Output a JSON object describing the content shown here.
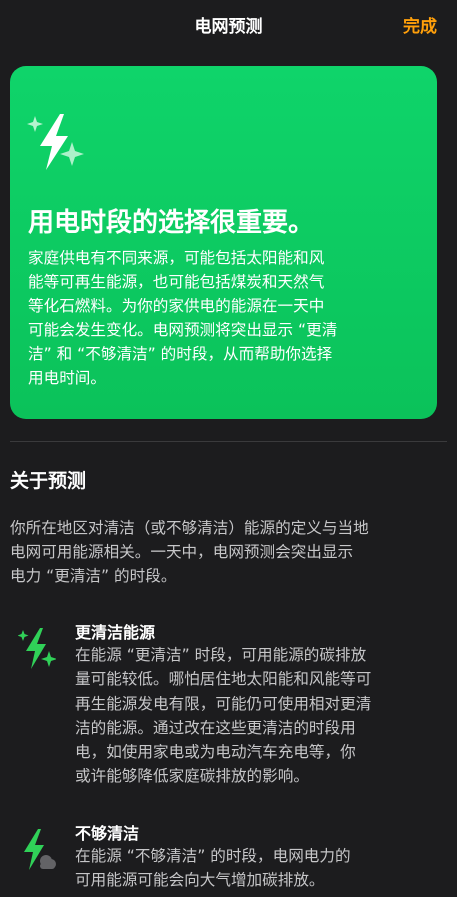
{
  "nav": {
    "title": "电网预测",
    "done": "完成"
  },
  "hero": {
    "icon": "sparkle-bolt-icon",
    "title": "用电时段的选择很重要。",
    "lines": [
      "家庭供电有不同来源，可能包括太阳能和风",
      "能等可再生能源，也可能包括煤炭和天然气",
      "等化石燃料。为你的家供电的能源在一天中",
      "可能会发生变化。电网预测将突出显示 “更清",
      "洁” 和 “不够清洁” 的时段，从而帮助你选择",
      "用电时间。"
    ],
    "color": "#0fd46a"
  },
  "about": {
    "title": "关于预测",
    "lines": [
      "你所在地区对清洁（或不够清洁）能源的定义与当地",
      "电网可用能源相关。一天中，电网预测会突出显示",
      "电力 “更清洁” 的时段。"
    ]
  },
  "clean": {
    "icon": "sparkle-bolt-icon",
    "title": "更清洁能源",
    "lines": [
      "在能源 “更清洁” 时段，可用能源的碳排放",
      "量可能较低。哪怕居住地太阳能和风能等可",
      "再生能源发电有限，可能仍可使用相对更清",
      "洁的能源。通过改在这些更清洁的时段用",
      "电，如使用家电或为电动汽车充电等，你",
      "或许能够降低家庭碳排放的影响。"
    ]
  },
  "less_clean": {
    "icon": "bolt-cloud-icon",
    "title": "不够清洁",
    "lines": [
      "在能源 “不够清洁” 的时段，电网电力的",
      "可用能源可能会向大气增加碳排放。"
    ]
  },
  "colors": {
    "accent": "#ff9f0a",
    "green": "#30d158",
    "background": "#1c1c1e"
  }
}
